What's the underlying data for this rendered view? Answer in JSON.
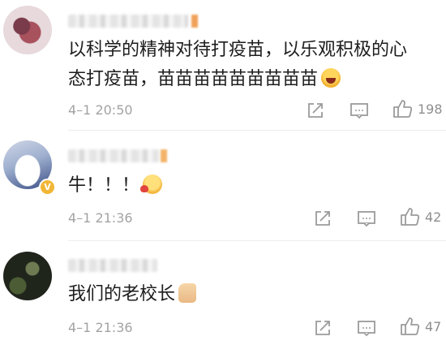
{
  "comments": [
    {
      "text_line1": "以科学的精神对待打疫苗，以乐观积极的心",
      "text_line2": "态打疫苗，苗苗苗苗苗苗苗苗苗",
      "emoji": "laughing-emoji",
      "timestamp": "4–1 20:50",
      "likes": "198"
    },
    {
      "text_line1": "牛！！！",
      "emoji": "kiss-emoji",
      "timestamp": "4–1 21:36",
      "likes": "42",
      "verified_badge": "V"
    },
    {
      "text_line1": "我们的老校长",
      "emoji": "thumbs-up-emoji",
      "timestamp": "4–1 21:36",
      "likes": "47"
    }
  ],
  "icons": {
    "share": "share-icon",
    "reply": "comment-icon",
    "like": "thumbs-up-icon"
  },
  "colors": {
    "meta_text": "#a3a3a3",
    "icon": "#9b9b9b",
    "verified_badge": "#f2b636"
  }
}
